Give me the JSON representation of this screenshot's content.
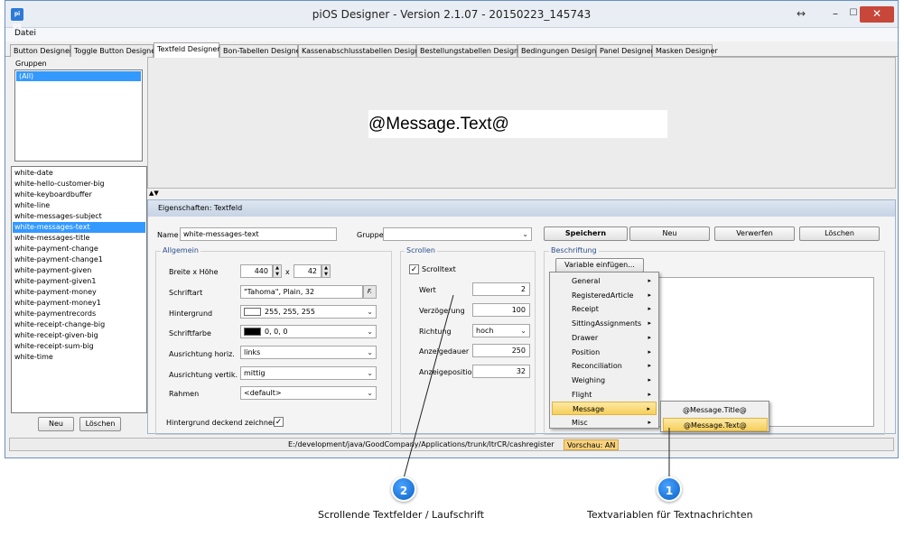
{
  "window": {
    "title": "piOS Designer - Version 2.1.07 - 20150223_145743",
    "app_icon_label": "pi OS",
    "controls": {
      "resize": "↔",
      "minimize": "–",
      "maximize": "☐",
      "close": "✕"
    }
  },
  "menu": {
    "file": "Datei"
  },
  "tabs": [
    "Button Designer",
    "Toggle Button Designer",
    "Textfeld Designer",
    "Bon-Tabellen Designer",
    "Kassenabschlusstabellen Designer",
    "Bestellungstabellen Designer",
    "Bedingungen Designer",
    "Panel Designer",
    "Masken Designer"
  ],
  "active_tab_index": 2,
  "groups": {
    "label": "Gruppen",
    "items": [
      "(All)"
    ],
    "selected": 0
  },
  "fields_list": {
    "items": [
      "white-date",
      "white-hello-customer-big",
      "white-keyboardbuffer",
      "white-line",
      "white-messages-subject",
      "white-messages-text",
      "white-messages-title",
      "white-payment-change",
      "white-payment-change1",
      "white-payment-given",
      "white-payment-given1",
      "white-payment-money",
      "white-payment-money1",
      "white-paymentrecords",
      "white-receipt-change-big",
      "white-receipt-given-big",
      "white-receipt-sum-big",
      "white-time"
    ],
    "selected": 5,
    "new_label": "Neu",
    "delete_label": "Löschen"
  },
  "preview": {
    "text": "@Message.Text@",
    "collapse_arrows": "▲▼"
  },
  "properties": {
    "title": "Eigenschaften: Textfeld",
    "name_label": "Name",
    "name_value": "white-messages-text",
    "group_label": "Gruppe",
    "group_value": "",
    "buttons": {
      "save": "Speichern",
      "new": "Neu",
      "discard": "Verwerfen",
      "delete": "Löschen"
    },
    "general": {
      "title": "Allgemein",
      "size_label": "Breite x Höhe",
      "width": "440",
      "size_sep": "x",
      "height": "42",
      "font_label": "Schriftart",
      "font_value": "\"Tahoma\", Plain, 32",
      "font_btn": "F.",
      "bg_label": "Hintergrund",
      "bg_value": "255, 255, 255",
      "bg_color": "#ffffff",
      "fg_label": "Schriftfarbe",
      "fg_value": "0, 0, 0",
      "fg_color": "#000000",
      "halign_label": "Ausrichtung horiz.",
      "halign_value": "links",
      "valign_label": "Ausrichtung vertik.",
      "valign_value": "mittig",
      "border_label": "Rahmen",
      "border_value": "<default>",
      "opaque_label": "Hintergrund deckend zeichnen"
    },
    "scroll": {
      "title": "Scrollen",
      "scroll_text_label": "Scrolltext",
      "value_label": "Wert",
      "value": "2",
      "delay_label": "Verzögerung",
      "delay": "100",
      "direction_label": "Richtung",
      "direction": "hoch",
      "duration_label": "Anzeigedauer",
      "duration": "250",
      "position_label": "Anzeigeposition",
      "position": "32"
    },
    "caption": {
      "title": "Beschriftung",
      "insert_variable": "Variable einfügen..."
    }
  },
  "variable_menu": {
    "items": [
      "General",
      "RegisteredArticle",
      "Receipt",
      "SittingAssignments",
      "Drawer",
      "Position",
      "Reconciliation",
      "Weighing",
      "Flight",
      "Message",
      "Misc"
    ],
    "highlighted": 9,
    "submenu": [
      "@Message.Title@",
      "@Message.Text@"
    ],
    "submenu_highlighted": 1
  },
  "status": {
    "path": "E:/development/java/GoodCompany/Applications/trunk/ltrCR/cashregister",
    "preview": "Vorschau: AN"
  },
  "callouts": [
    {
      "number": "1",
      "text": "Textvariablen für Textnachrichten"
    },
    {
      "number": "2",
      "text": "Scrollende Textfelder / Laufschrift"
    }
  ]
}
